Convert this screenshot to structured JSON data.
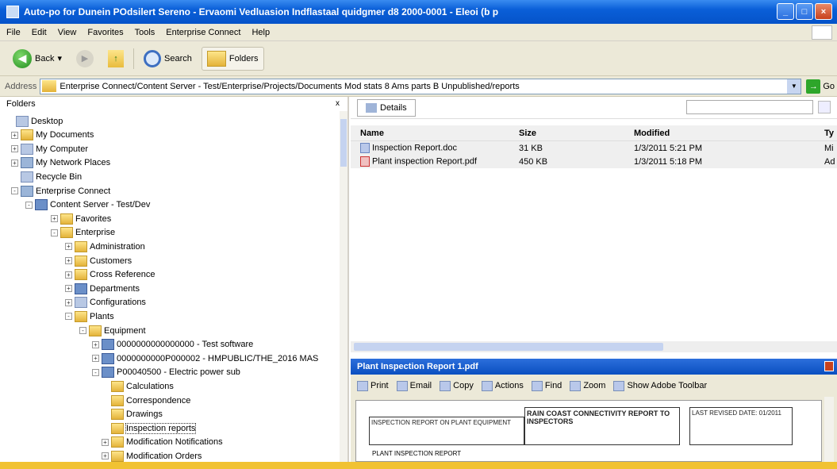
{
  "window": {
    "title": "Auto-po for Dunein POdsilert Sereno - Ervaomi Vedluasion Indflastaal quidgmer d8 2000-0001 - Eleoi (b p",
    "buttons": {
      "minimize": "_",
      "maximize": "□",
      "close": "×"
    }
  },
  "menu": [
    "File",
    "Edit",
    "View",
    "Favorites",
    "Tools",
    "Enterprise Connect",
    "Help"
  ],
  "toolbar": {
    "back": "Back",
    "search": "Search",
    "folders": "Folders"
  },
  "address": {
    "label": "Address",
    "value": "Enterprise Connect/Content Server - Test/Enterprise/Projects/Documents  Mod stats  8 Ams parts B  Unpublished/reports",
    "go": "Go"
  },
  "folders_panel": {
    "header": "Folders",
    "close": "x",
    "items": [
      {
        "label": "Desktop",
        "indent": 0,
        "pm": "",
        "icon": "sys"
      },
      {
        "label": "My Documents",
        "indent": 1,
        "pm": "+",
        "icon": "folder"
      },
      {
        "label": "My Computer",
        "indent": 1,
        "pm": "+",
        "icon": "sys"
      },
      {
        "label": "My Network Places",
        "indent": 1,
        "pm": "+",
        "icon": "net"
      },
      {
        "label": "Recycle Bin",
        "indent": 1,
        "pm": "",
        "icon": "sys"
      },
      {
        "label": "Enterprise Connect",
        "indent": 1,
        "pm": "-",
        "icon": "net"
      },
      {
        "label": "Content Server - Test/Dev",
        "indent": 2,
        "pm": "-",
        "icon": "group"
      },
      {
        "label": "Favorites",
        "indent": 3,
        "pm": "+",
        "icon": "folder"
      },
      {
        "label": "Enterprise",
        "indent": 3,
        "pm": "-",
        "icon": "folder"
      },
      {
        "label": "Administration",
        "indent": 4,
        "pm": "+",
        "icon": "folder"
      },
      {
        "label": "Customers",
        "indent": 4,
        "pm": "+",
        "icon": "folder"
      },
      {
        "label": "Cross Reference",
        "indent": 4,
        "pm": "+",
        "icon": "folder"
      },
      {
        "label": "Departments",
        "indent": 4,
        "pm": "+",
        "icon": "group"
      },
      {
        "label": "Configurations",
        "indent": 4,
        "pm": "+",
        "icon": "sys"
      },
      {
        "label": "Plants",
        "indent": 4,
        "pm": "-",
        "icon": "folder"
      },
      {
        "label": "Equipment",
        "indent": 5,
        "pm": "-",
        "icon": "folder"
      },
      {
        "label": "0000000000000000 - Test software",
        "indent": 6,
        "pm": "+",
        "icon": "group"
      },
      {
        "label": "0000000000P000002 - HMPUBLIC/THE_2016 MAS",
        "indent": 6,
        "pm": "+",
        "icon": "group"
      },
      {
        "label": "P00040500 - Electric power sub",
        "indent": 6,
        "pm": "-",
        "icon": "group"
      },
      {
        "label": "Calculations",
        "indent": 7,
        "pm": "",
        "icon": "folder"
      },
      {
        "label": "Correspondence",
        "indent": 7,
        "pm": "",
        "icon": "folder"
      },
      {
        "label": "Drawings",
        "indent": 7,
        "pm": "",
        "icon": "folder"
      },
      {
        "label": "Inspection reports",
        "indent": 7,
        "pm": "",
        "icon": "folder",
        "selected": true
      },
      {
        "label": "Modification Notifications",
        "indent": 7,
        "pm": "+",
        "icon": "folder"
      },
      {
        "label": "Modification Orders",
        "indent": 7,
        "pm": "+",
        "icon": "folder"
      }
    ]
  },
  "content": {
    "tab": "Details",
    "columns": [
      "Name",
      "Size",
      "Modified",
      "Ty"
    ],
    "files": [
      {
        "name": "Inspection Report.doc",
        "size": "31 KB",
        "modified": "1/3/2011 5:21 PM",
        "type": "Mi",
        "icon": "doc"
      },
      {
        "name": "Plant inspection Report.pdf",
        "size": "450 KB",
        "modified": "1/3/2011 5:18 PM",
        "type": "Ad",
        "icon": "pdf"
      }
    ]
  },
  "preview": {
    "title": "Plant Inspection Report 1.pdf",
    "tools": [
      "Print",
      "Email",
      "Copy",
      "Actions",
      "Find",
      "Zoom",
      "Show Adobe Toolbar"
    ],
    "doc": {
      "box1": "INSPECTION REPORT ON PLANT EQUIPMENT",
      "box2": "RAIN COAST CONNECTIVITY REPORT TO INSPECTORS",
      "box3": "LAST REVISED DATE: 01/2011",
      "footer": "PLANT INSPECTION REPORT"
    }
  }
}
